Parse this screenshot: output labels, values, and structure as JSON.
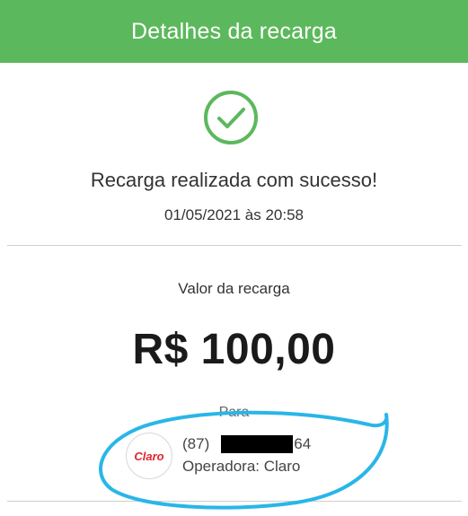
{
  "header": {
    "title": "Detalhes da recarga"
  },
  "status": {
    "icon": "check-circle-icon",
    "message": "Recarga realizada com sucesso!",
    "datetime": "01/05/2021 às 20:58"
  },
  "recharge": {
    "amount_label": "Valor da recarga",
    "amount": "R$ 100,00"
  },
  "recipient": {
    "to_label": "Para",
    "phone_prefix": "(87)",
    "phone_suffix": "64",
    "operator_logo_text": "Claro",
    "operator_text": "Operadora: Claro"
  },
  "colors": {
    "header_bg": "#5cb85c",
    "check": "#5cb85c",
    "operator_brand": "#e3262d",
    "annotation": "#29b6e8"
  }
}
